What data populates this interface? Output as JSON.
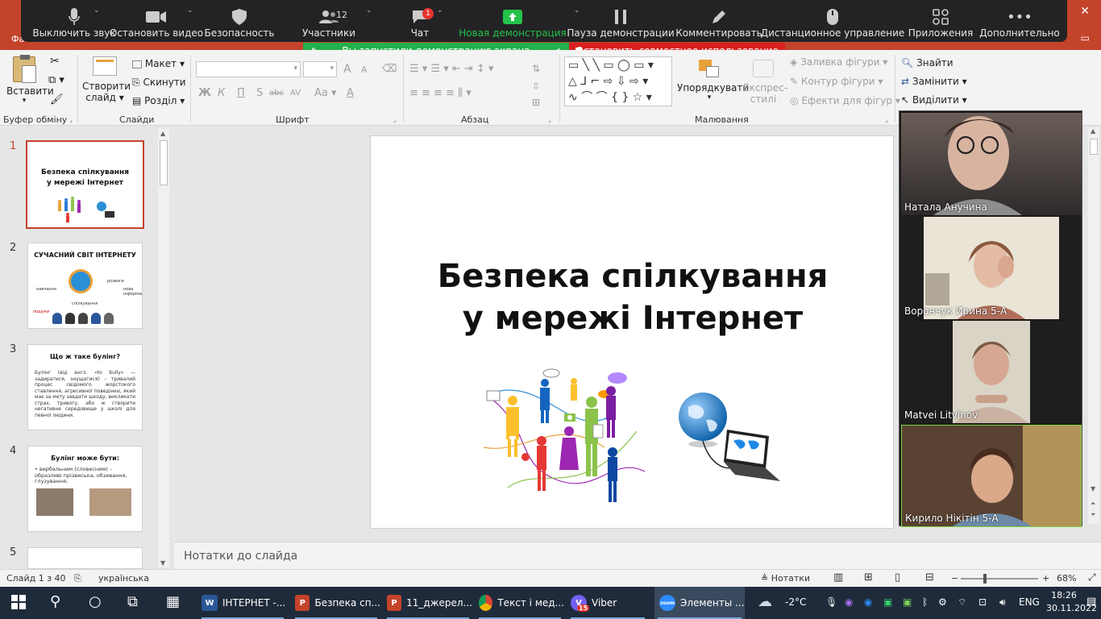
{
  "ppt": {
    "file_tab": "Фай",
    "close_icon": "✕",
    "restore_icon": "▭"
  },
  "zoom_toolbar": {
    "mute": "Выключить звук",
    "video": "Остановить видео",
    "security": "Безопасность",
    "participants": "Участники",
    "participants_count": "12",
    "chat": "Чат",
    "chat_badge": "1",
    "new_share": "Новая демонстрация",
    "pause_share": "Пауза демонстрации",
    "annotate": "Комментировать",
    "remote_control": "Дистанционное управление",
    "apps": "Приложения",
    "more": "Дополнительно"
  },
  "share_notice": {
    "started": "Вы запустили демонстрацию экрана",
    "stop": "Остановить совместное использование"
  },
  "ribbon": {
    "clipboard": {
      "paste": "Вставити",
      "label": "Буфер обміну"
    },
    "slides": {
      "new_slide_1": "Створити",
      "new_slide_2": "слайд",
      "layout": "Макет",
      "reset": "Скинути",
      "section": "Розділ",
      "label": "Слайди"
    },
    "font": {
      "label": "Шрифт",
      "bold": "Ж",
      "italic": "К",
      "underline": "П",
      "strike": "S",
      "shadow": "abc",
      "spacing": "AV",
      "case": "Aa",
      "color": "A",
      "grow": "A",
      "shrink": "A"
    },
    "paragraph": {
      "label": "Абзац"
    },
    "drawing": {
      "arrange": "Упорядкувати",
      "quick_styles_1": "Експрес-",
      "quick_styles_2": "стилі",
      "fill": "Заливка фігури",
      "outline": "Контур фігури",
      "effects": "Ефекти для фігур",
      "label": "Малювання"
    },
    "editing": {
      "find": "Знайти",
      "replace": "Замінити",
      "select": "Виділити"
    }
  },
  "slides": [
    {
      "num": "1",
      "title_1": "Безпека спілкування",
      "title_2": "у мережі Інтернет"
    },
    {
      "num": "2",
      "title": "СУЧАСНИЙ СВІТ ІНТЕРНЕТУ",
      "w1": "навчання",
      "w2": "розваги",
      "w3": "нова інформація",
      "w4": "спілкування",
      "w5": "пошуки",
      "w6": "покупки"
    },
    {
      "num": "3",
      "title": "Що ж таке булінг?",
      "body": "Булінг (від англ. «to bully» — задиратися, знущатися) – тривалий процес свідомого жорстокого ставлення, агресивної поведінки, який має за мету завдати шкоду, викликати страх, тривогу, або ж створити негативне середовище у школі для певної людини."
    },
    {
      "num": "4",
      "title": "Булінг може бути:",
      "body": "• вербальним (словесним) – образливі прізвиська, обзивання, глузування;"
    },
    {
      "num": "5"
    }
  ],
  "main_slide": {
    "title_1": "Безпека спілкування",
    "title_2": "у мережі Інтернет"
  },
  "notes_placeholder": "Нотатки до слайда",
  "participants": [
    {
      "name": "Натала Анучина"
    },
    {
      "name": "Ворончук Ирина 5-А"
    },
    {
      "name": "Matvei Litvinov"
    },
    {
      "name": "Кирило Нікітін 5-А"
    }
  ],
  "status": {
    "slide": "Слайд 1 з 40",
    "language": "українська",
    "notes": "Нотатки",
    "zoom": "68%"
  },
  "taskbar": {
    "apps": [
      {
        "label": "ІНТЕРНЕТ -...",
        "icon": "W",
        "color": "#2b579a"
      },
      {
        "label": "Безпека сп...",
        "icon": "P",
        "color": "#c4432b"
      },
      {
        "label": "11_джерел...",
        "icon": "P",
        "color": "#c4432b"
      },
      {
        "label": "Текст і мед...",
        "icon": "●",
        "color": "#db4437"
      },
      {
        "label": "Viber",
        "icon": "V",
        "color": "#7360f2"
      },
      {
        "label": "Элементы ...",
        "icon": "zoom",
        "color": "#2d8cff"
      }
    ],
    "viber_badge": "15",
    "weather": "-2°C",
    "lang": "ENG",
    "time": "18:26",
    "date": "30.11.2022"
  }
}
